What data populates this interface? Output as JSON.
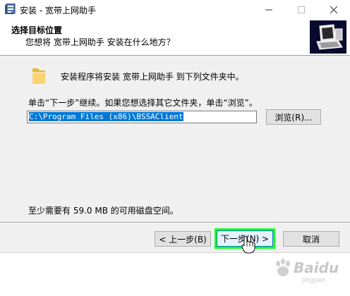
{
  "window": {
    "title": "安装 - 宽带上网助手",
    "controls": {
      "minimize_icon": "minimize-icon",
      "maximize_icon": "maximize-icon",
      "close_icon": "close-icon"
    }
  },
  "header": {
    "title": "选择目标位置",
    "subtitle": "您想将 宽带上网助手 安装在什么地方？",
    "logo_icon": "installer-computer-icon"
  },
  "body": {
    "intro": "安装程序将安装 宽带上网助手 到下列文件夹中。",
    "instruction": "单击“下一步”继续。如果您想选择其它文件夹，单击“浏览”。",
    "install_path": "C:\\Program Files (x86)\\BSSAClient",
    "browse_label": "浏览(R)...",
    "space_required": "至少需要有 59.0 MB 的可用磁盘空间。"
  },
  "footer": {
    "back_label": "< 上一步(B)",
    "next_label": "下一步(N) >",
    "cancel_label": "取消"
  },
  "watermark": {
    "text": "Baidu",
    "sub": "jingyan"
  },
  "colors": {
    "highlight_box": "#1aff1a",
    "selection": "#0078d7",
    "logo_bg": "#0a0a2e"
  }
}
